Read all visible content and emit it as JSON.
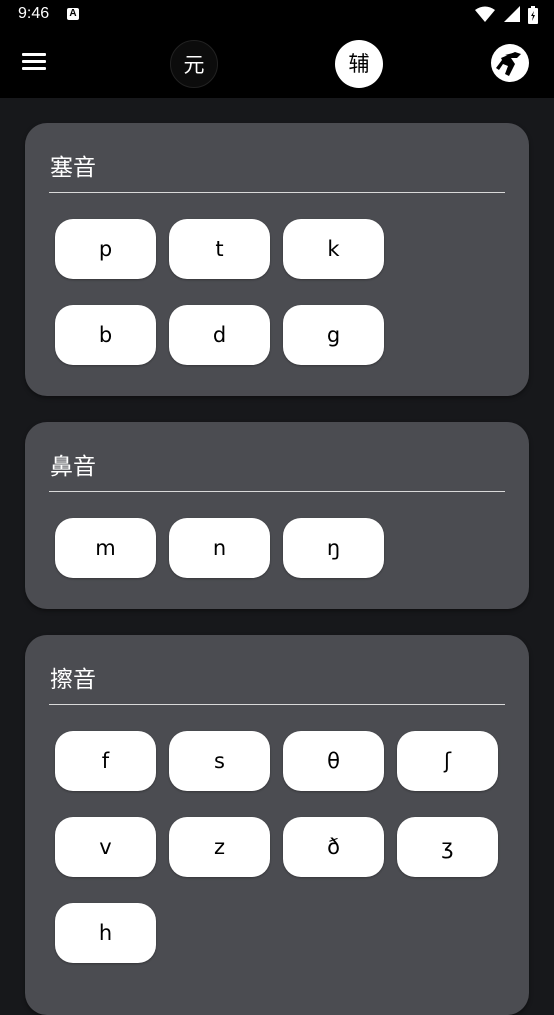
{
  "status_bar": {
    "time": "9:46",
    "notification_icon": "A"
  },
  "app_bar": {
    "menu_icon": "menu-icon",
    "tabs": [
      {
        "label": "元",
        "selected": false
      },
      {
        "label": "辅",
        "selected": true
      }
    ],
    "logo_icon": "runner-logo-icon"
  },
  "sections": [
    {
      "title": "塞音",
      "rows": [
        [
          "p",
          "t",
          "k"
        ],
        [
          "b",
          "d",
          "g"
        ]
      ]
    },
    {
      "title": "鼻音",
      "rows": [
        [
          "m",
          "n",
          "ŋ"
        ]
      ]
    },
    {
      "title": "擦音",
      "rows": [
        [
          "f",
          "s",
          "θ",
          "ʃ"
        ],
        [
          "v",
          "z",
          "ð",
          "ʒ"
        ],
        [
          "h"
        ]
      ]
    }
  ],
  "colors": {
    "background": "#17181b",
    "card": "#4b4c51",
    "bar": "#000000",
    "button": "#ffffff"
  }
}
